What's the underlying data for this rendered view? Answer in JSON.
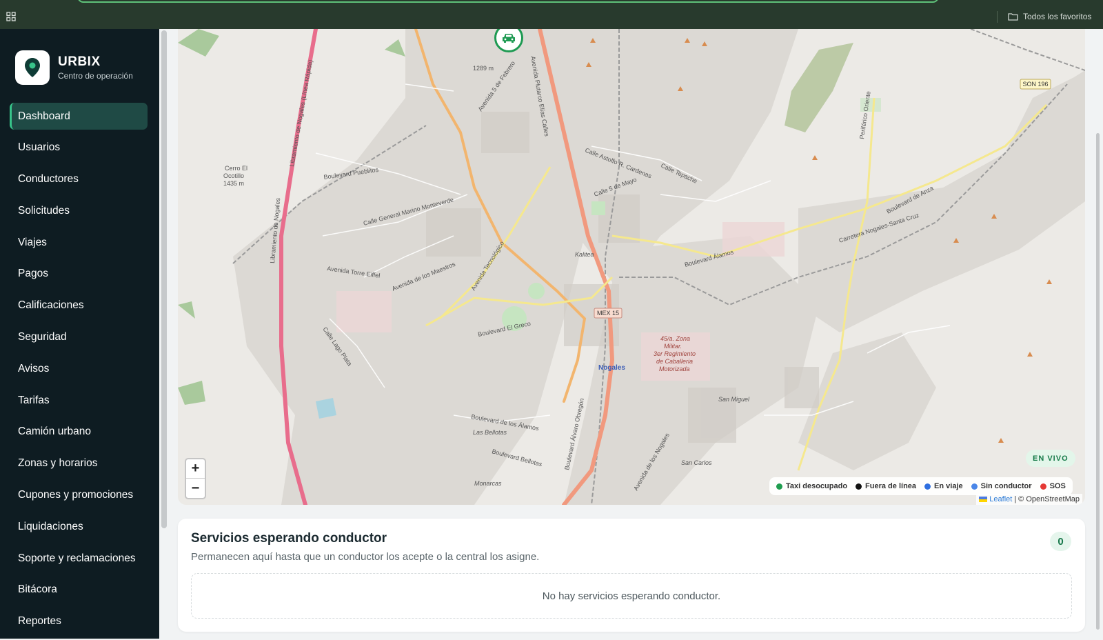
{
  "bookmarks": {
    "favorites_label": "Todos los favoritos"
  },
  "brand": {
    "name": "URBIX",
    "subtitle": "Centro de operación"
  },
  "sidebar": {
    "items": [
      {
        "label": "Dashboard",
        "active": true
      },
      {
        "label": "Usuarios"
      },
      {
        "label": "Conductores"
      },
      {
        "label": "Solicitudes"
      },
      {
        "label": "Viajes"
      },
      {
        "label": "Pagos"
      },
      {
        "label": "Calificaciones"
      },
      {
        "label": "Seguridad"
      },
      {
        "label": "Avisos"
      },
      {
        "label": "Tarifas"
      },
      {
        "label": "Camión urbano"
      },
      {
        "label": "Zonas y horarios"
      },
      {
        "label": "Cupones y promociones"
      },
      {
        "label": "Liquidaciones"
      },
      {
        "label": "Soporte y reclamaciones"
      },
      {
        "label": "Bitácora"
      },
      {
        "label": "Reportes"
      }
    ]
  },
  "map": {
    "live_badge": "EN VIVO",
    "zoom_in": "+",
    "zoom_out": "−",
    "legend": [
      {
        "label": "Taxi desocupado",
        "color": "#1f9d4f"
      },
      {
        "label": "Fuera de línea",
        "color": "#111111"
      },
      {
        "label": "En viaje",
        "color": "#2f6fe0"
      },
      {
        "label": "Sin conductor",
        "color": "#4a86e8"
      },
      {
        "label": "SOS",
        "color": "#e53935"
      }
    ],
    "attribution": {
      "leaflet": "Leaflet",
      "separator": "|",
      "osm": "© OpenStreetMap"
    },
    "labels": {
      "hill_name": "Cerro El",
      "hill_name2": "Ocotillo",
      "hill_elev": "1435 m",
      "peak_elev": "1289 m",
      "shield_mex": "MEX 15",
      "shield_son": "SON 196",
      "city": "Nogales",
      "kalitea": "Kalitea",
      "zona1": "45/a. Zona",
      "zona2": "Militar.",
      "zona3": "3er Regimiento",
      "zona4": "de Caballeria",
      "zona5": "Motorizada",
      "san_miguel": "San Miguel",
      "san_carlos": "San Carlos",
      "las_bellotas": "Las Bellotas",
      "monarcas": "Monarcas",
      "blvd_alamos": "Boulevard Álamos",
      "blvd_elgreco": "Boulevard El Greco",
      "blvd_pueblitos": "Boulevard Pueblitos",
      "blvd_anza": "Boulevard de Anza",
      "blvd_bellotas": "Boulevard Bellotas",
      "blvd_losalamos": "Boulevard de los Álamos",
      "calle_marino": "Calle General Marino Monteverde",
      "av_torre": "Avenida Torre Eiffel",
      "av_maestros": "Avenida de los Maestros",
      "calle_lago": "Calle Lago Plata",
      "calle_tepache": "Calle Tepache",
      "calle_cardenas": "Calle Astolfo R. Cardenas",
      "calle_5mayo": "Calle 5 de Mayo",
      "av_5feb": "Avenida 5 de Febrero",
      "av_tecnologico": "Avenida Tecnológico",
      "periferico": "Periférico Oriente",
      "carretera": "Carretera Nogales-Santa Cruz",
      "libramiento": "Libramiento de Nogales (Línea Rápida)",
      "libramiento2": "Libramiento de Nogales",
      "blvd_obregon": "Boulevard Álvaro Obregón",
      "av_elias": "Avenida Plutarco Elías Calles",
      "av_nogales": "Avenida de los Nogales"
    }
  },
  "pending": {
    "title": "Servicios esperando conductor",
    "description": "Permanecen aquí hasta que un conductor los acepte o la central los asigne.",
    "count": "0",
    "empty_text": "No hay servicios esperando conductor."
  }
}
